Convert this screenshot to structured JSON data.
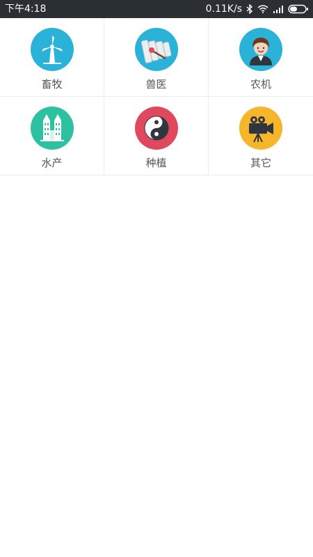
{
  "status_bar": {
    "time": "下午4:18",
    "net_speed": "0.11K/s",
    "bluetooth_icon": "bluetooth-icon",
    "wifi_icon": "wifi-icon",
    "signal_icon": "signal-icon",
    "battery_icon": "battery-icon",
    "background": "#2b2f33"
  },
  "categories": [
    {
      "label": "畜牧",
      "icon": "windmill-icon",
      "color": "#2bb2d8"
    },
    {
      "label": "兽医",
      "icon": "xylophone-icon",
      "color": "#2bb2d8"
    },
    {
      "label": "农机",
      "icon": "person-icon",
      "color": "#2bb2d8"
    },
    {
      "label": "水产",
      "icon": "buildings-icon",
      "color": "#2ec1a1"
    },
    {
      "label": "种植",
      "icon": "yin-yang-icon",
      "color": "#e0485d"
    },
    {
      "label": "其它",
      "icon": "camera-icon",
      "color": "#f6b62c"
    }
  ]
}
